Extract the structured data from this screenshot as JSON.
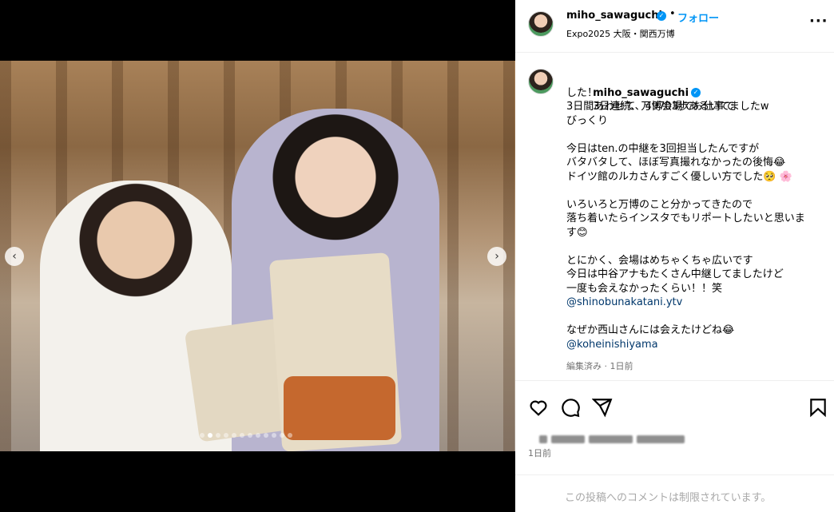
{
  "post": {
    "username": "miho_sawaguchi",
    "verified_icon": "verified-badge-icon",
    "separator": "•",
    "follow_label": "フォロー",
    "location": "Expo2025 大阪・関西万博",
    "more_icon": "more-options-icon",
    "more_glyph": "···"
  },
  "media": {
    "prev_glyph": "‹",
    "next_glyph": "›",
    "slide_count": 12,
    "active_slide": 1
  },
  "caption": {
    "username": "miho_sawaguchi",
    "first_line": "3日連続、万博会場でお仕事で",
    "lines": [
      "した！",
      "3日間あわせて、49703歩あるいてましたw",
      "びっくり",
      "",
      "今日はten.の中継を3回担当したんですが",
      "バタバタして、ほぼ写真撮れなかったの後悔😂",
      "ドイツ館のルカさんすごく優しい方でした🥺 🌸",
      "",
      "いろいろと万博のこと分かってきたので",
      "落ち着いたらインスタでもリポートしたいと思いま",
      "す😊",
      "",
      "とにかく、会場はめちゃくちゃ広いです",
      "今日は中谷アナもたくさん中継してましたけど",
      "一度も会えなかったくらい！！笑"
    ],
    "mention1": "@shinobunakatani.ytv",
    "line_after_mention1": "なぜか西山さんには会えたけどね😂",
    "mention2": "@koheinishiyama",
    "meta": "編集済み · 1日前"
  },
  "actions": {
    "like_icon": "heart-icon",
    "comment_icon": "comment-icon",
    "share_icon": "share-icon",
    "save_icon": "bookmark-icon"
  },
  "time_ago": "1日前",
  "comments_disabled": "この投稿へのコメントは制限されています。"
}
